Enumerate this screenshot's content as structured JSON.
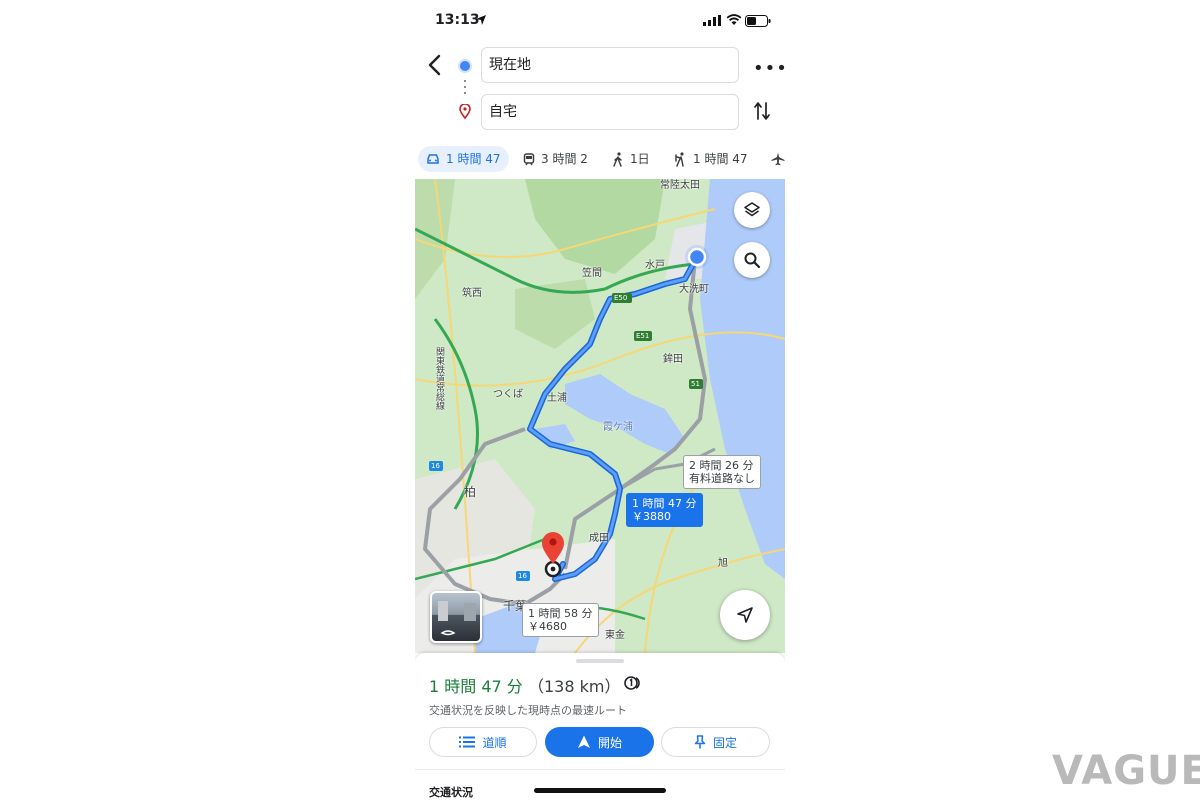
{
  "status_bar": {
    "time": "13:13"
  },
  "directions": {
    "origin": "現在地",
    "destination": "自宅"
  },
  "modes": [
    {
      "icon": "car-icon",
      "label": "1 時間 47",
      "active": true
    },
    {
      "icon": "train-icon",
      "label": "3 時間 2"
    },
    {
      "icon": "walk-icon",
      "label": "1日"
    },
    {
      "icon": "ride-icon",
      "label": "1 時間 47"
    },
    {
      "icon": "plane-icon",
      "label": ""
    }
  ],
  "map": {
    "places": [
      "常陸太田",
      "水戸",
      "笠間",
      "大洗町",
      "筑西",
      "つくば",
      "土浦",
      "鉾田",
      "霞ケ浦",
      "柏",
      "成田",
      "旭",
      "千葉",
      "東金",
      "関東鉄道常総線",
      "E50",
      "E51",
      "51",
      "16"
    ],
    "routes": [
      {
        "time": "1 時間 47 分",
        "cost": "￥3880",
        "selected": true
      },
      {
        "time": "2 時間 26 分",
        "cost": "有料道路なし"
      },
      {
        "time": "1 時間 58 分",
        "cost": "￥4680"
      }
    ]
  },
  "summary": {
    "eta": "1 時間 47 分",
    "distance": "（138 km）",
    "description": "交通状況を反映した現時点の最速ルート",
    "steps_label": "道順",
    "start_label": "開始",
    "pin_label": "固定",
    "traffic_label": "交通状況"
  },
  "watermark": "VAGUE",
  "colors": {
    "accent": "#1a73e8",
    "eta_green": "#188038",
    "route_blue": "#4285f4",
    "alt_route": "#9aa0a6"
  }
}
